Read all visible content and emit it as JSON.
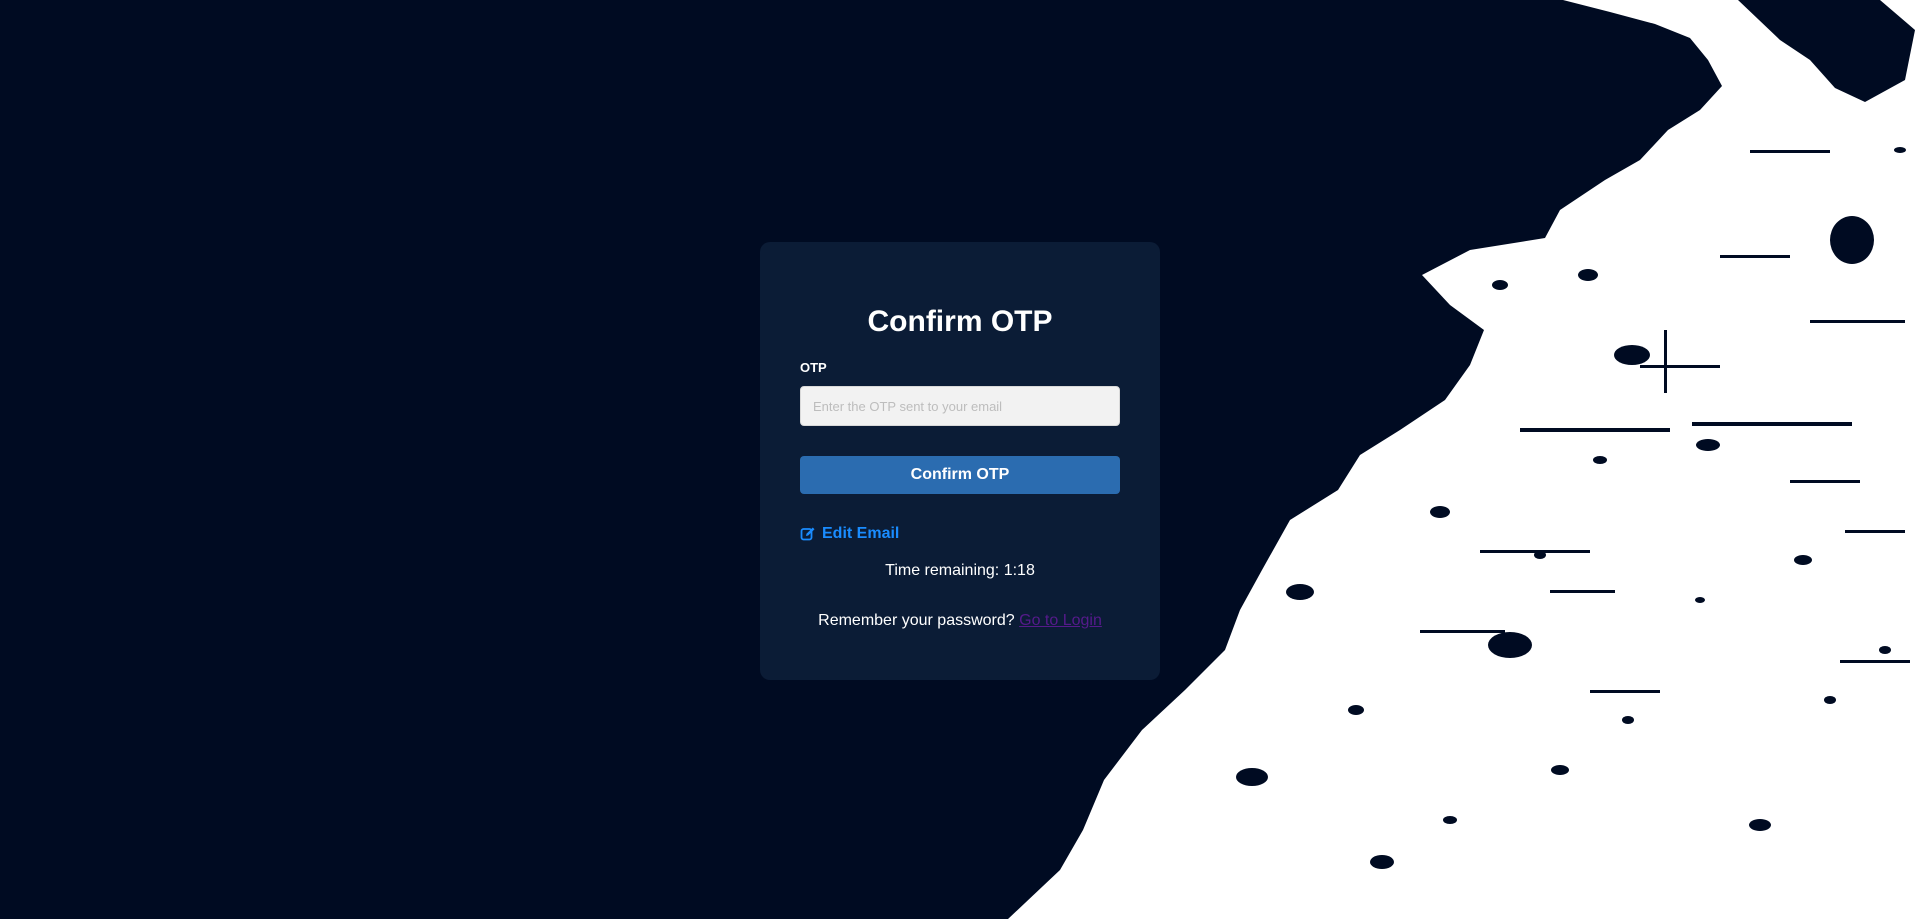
{
  "form": {
    "title": "Confirm OTP",
    "otp_label": "OTP",
    "otp_placeholder": "Enter the OTP sent to your email",
    "otp_value": "",
    "confirm_button": "Confirm OTP",
    "edit_email_link": "Edit Email",
    "timer_text": "Time remaining: 1:18",
    "remember_text": "Remember your password?",
    "login_link": "Go to Login"
  },
  "icons": {
    "edit": "edit-icon"
  },
  "colors": {
    "background": "#000b22",
    "card": "#0b1c36",
    "primary_button": "#2b6cb0",
    "link_blue": "#1a8cff",
    "visited_link": "#551a8b",
    "splash": "#ffffff"
  }
}
